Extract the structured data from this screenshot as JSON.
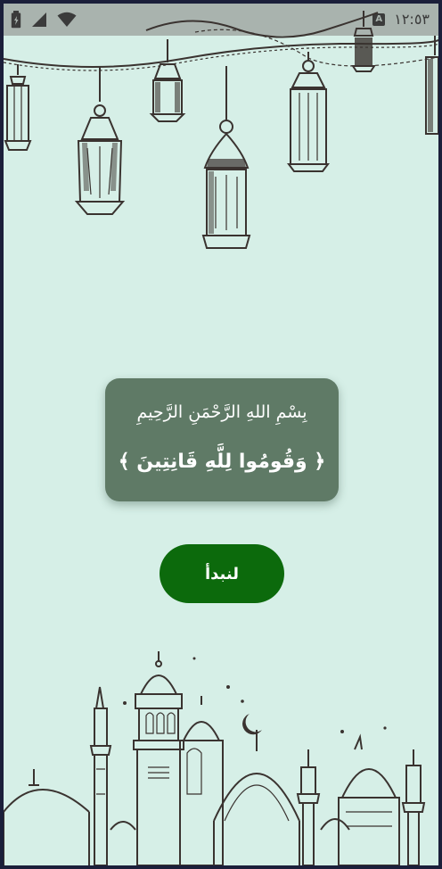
{
  "status_bar": {
    "time": "١٢:٥٣",
    "icons": [
      "battery-icon",
      "signal-icon",
      "wifi-icon",
      "keyboard-a-icon"
    ],
    "a_badge": "A"
  },
  "card": {
    "basmala": "بِسْمِ اللهِ الرَّحْمَنِ الرَّحِيمِ",
    "verse": "﴿ وَقُومُوا لِلَّهِ قَانِتِينَ ﴾"
  },
  "start_button": {
    "label": "لنبدأ"
  },
  "colors": {
    "background": "#d6efe7",
    "card": "#5f7a66",
    "button": "#0c6a0c",
    "status_bar": "#a9b3ae"
  }
}
